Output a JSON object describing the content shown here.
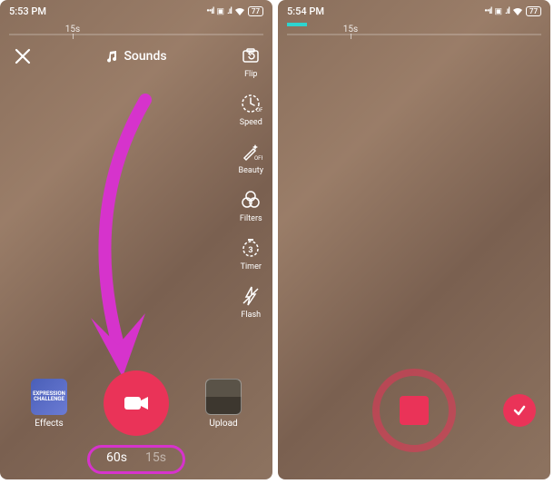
{
  "left": {
    "status": {
      "time": "5:53 PM",
      "battery": "77"
    },
    "timeline_label": "15s",
    "sounds_label": "Sounds",
    "tools": {
      "flip": "Flip",
      "speed": "Speed",
      "beauty": "Beauty",
      "filters": "Filters",
      "timer": "Timer",
      "flash": "Flash"
    },
    "bottom": {
      "effects": "Effects",
      "upload": "Upload"
    },
    "duration": {
      "opt60": "60s",
      "opt15": "15s"
    }
  },
  "right": {
    "status": {
      "time": "5:54 PM",
      "battery": "77"
    },
    "timeline_label": "15s"
  }
}
